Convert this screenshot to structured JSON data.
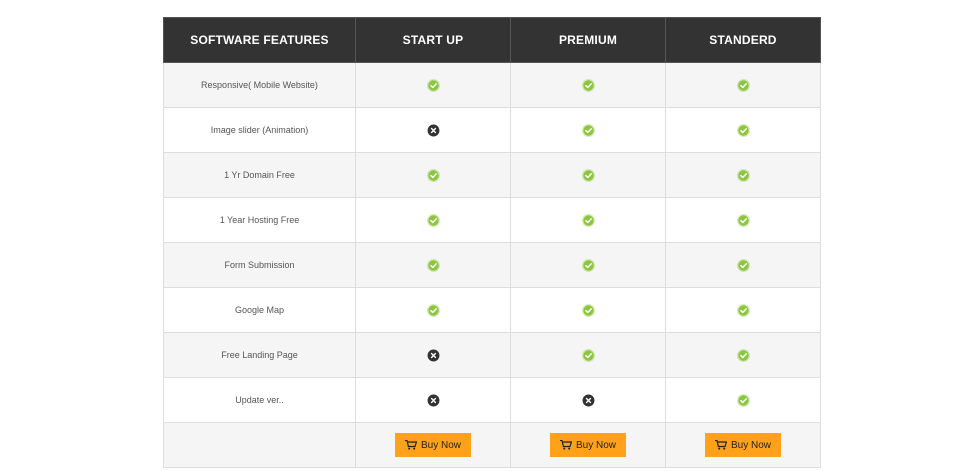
{
  "header": {
    "feature_col": "SOFTWARE FEATURES",
    "plans": [
      "START UP",
      "PREMIUM",
      "STANDERD"
    ]
  },
  "rows": [
    {
      "feature": "Responsive( Mobile Website)",
      "values": [
        "check",
        "check",
        "check"
      ]
    },
    {
      "feature": "Image slider (Animation)",
      "values": [
        "cross",
        "check",
        "check"
      ]
    },
    {
      "feature": "1 Yr Domain Free",
      "values": [
        "check",
        "check",
        "check"
      ]
    },
    {
      "feature": "1 Year Hosting Free",
      "values": [
        "check",
        "check",
        "check"
      ]
    },
    {
      "feature": "Form Submission",
      "values": [
        "check",
        "check",
        "check"
      ]
    },
    {
      "feature": "Google Map",
      "values": [
        "check",
        "check",
        "check"
      ]
    },
    {
      "feature": "Free Landing Page",
      "values": [
        "cross",
        "check",
        "check"
      ]
    },
    {
      "feature": "Update ver..",
      "values": [
        "cross",
        "cross",
        "check"
      ]
    }
  ],
  "buy_label": "Buy Now",
  "colors": {
    "header_bg": "#333333",
    "check": "#8cc63f",
    "cross": "#333333",
    "button": "#ffa21a"
  }
}
